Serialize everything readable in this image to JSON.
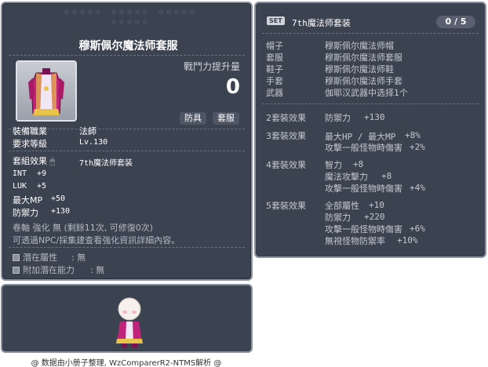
{
  "item_id": "01052795",
  "stars": "☆☆☆☆☆ ☆☆☆☆☆ ☆☆☆☆☆\n☆☆☆☆☆",
  "item": {
    "name": "穆斯佩尔魔法师套服",
    "power_label": "戰鬥力提升量",
    "power_value": "0",
    "tags": [
      "防具",
      "套服"
    ]
  },
  "requirements": [
    {
      "label": "裝備職業",
      "value": "法師"
    },
    {
      "label": "要求等級",
      "value": "Lv.130"
    }
  ],
  "set_effect": {
    "label": "套組效果",
    "value": "7th魔法师套装"
  },
  "stats": [
    {
      "label": "INT",
      "value": "+9"
    },
    {
      "label": "LUK",
      "value": "+5"
    },
    {
      "label": "最大MP",
      "value": "+50"
    },
    {
      "label": "防禦力",
      "value": "+130"
    }
  ],
  "upgrade_line": "卷軸 強化 無 (剩餘11次, 可修復0次)",
  "upgrade_hint": "可透過NPC/採集建查看強化資訊詳細內容。",
  "potentials": [
    {
      "label": "潛在屬性",
      "value": ": 無"
    },
    {
      "label": "附加潛在能力",
      "value": ": 無"
    }
  ],
  "set_panel": {
    "badge": "SET",
    "name": "7th魔法师套装",
    "count": "0 / 5",
    "pieces": [
      {
        "slot": "帽子",
        "name": "穆斯佩尔魔法师帽"
      },
      {
        "slot": "套服",
        "name": "穆斯佩尔魔法师套服"
      },
      {
        "slot": "鞋子",
        "name": "穆斯佩尔魔法师鞋"
      },
      {
        "slot": "手套",
        "name": "穆斯佩尔魔法师手套"
      },
      {
        "slot": "武器",
        "name": "伽耶汉武器中选择1个"
      }
    ],
    "effects": [
      {
        "tier": "2套裝效果",
        "lines": [
          {
            "k": "防禦力",
            "v": "+130"
          }
        ]
      },
      {
        "tier": "3套裝效果",
        "lines": [
          {
            "k": "最大HP / 最大MP",
            "v": "+8%"
          },
          {
            "k": "攻擊一般怪物時傷害",
            "v": "+2%"
          }
        ]
      },
      {
        "tier": "4套裝效果",
        "lines": [
          {
            "k": "智力",
            "v": "+8"
          },
          {
            "k": "魔法攻擊力",
            "v": "+8"
          },
          {
            "k": "攻擊一般怪物時傷害",
            "v": "+4%"
          }
        ]
      },
      {
        "tier": "5套裝效果",
        "lines": [
          {
            "k": "全部屬性",
            "v": "+10"
          },
          {
            "k": "防禦力",
            "v": "+220"
          },
          {
            "k": "攻擊一般怪物時傷害",
            "v": "+6%"
          },
          {
            "k": "無視怪物防禦率",
            "v": "+10%"
          }
        ]
      }
    ]
  },
  "footer": "@ 数据由小册子整理, WzComparerR2-NTMS解析 @",
  "colors": {
    "panel_bg": "#3c4350",
    "panel_border": "#8a92a0",
    "robe_magenta": "#c0247a",
    "robe_gold": "#e8c34a"
  }
}
